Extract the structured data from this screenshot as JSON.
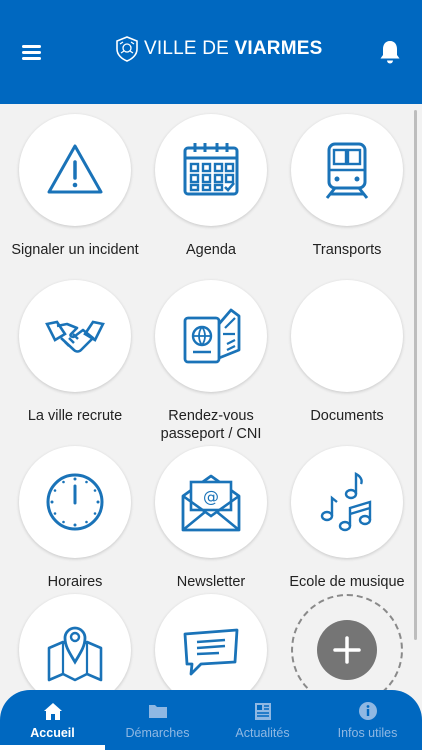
{
  "header": {
    "logo_text_light": "VILLE DE ",
    "logo_text_bold": "VIARMES",
    "menu_icon": "hamburger-menu-icon",
    "bell_icon": "bell-icon"
  },
  "tiles": [
    {
      "label": "Signaler un incident",
      "icon": "warning-icon"
    },
    {
      "label": "Agenda",
      "icon": "calendar-icon"
    },
    {
      "label": "Transports",
      "icon": "train-icon"
    },
    {
      "label": "La ville recrute",
      "icon": "handshake-icon"
    },
    {
      "label": "Rendez-vous passeport / CNI",
      "icon": "passport-icon"
    },
    {
      "label": "Documents",
      "icon": ""
    },
    {
      "label": "Horaires",
      "icon": "clock-icon"
    },
    {
      "label": "Newsletter",
      "icon": "email-envelope-icon"
    },
    {
      "label": "Ecole de musique",
      "icon": "music-notes-icon"
    },
    {
      "label": "",
      "icon": "map-pin-icon"
    },
    {
      "label": "",
      "icon": "chat-message-icon"
    }
  ],
  "add_button_icon": "plus-icon",
  "tabs": [
    {
      "label": "Accueil",
      "icon": "home-icon",
      "active": true
    },
    {
      "label": "Démarches",
      "icon": "folder-icon",
      "active": false
    },
    {
      "label": "Actualités",
      "icon": "newspaper-icon",
      "active": false
    },
    {
      "label": "Infos utiles",
      "icon": "info-icon",
      "active": false
    }
  ],
  "colors": {
    "brand_blue": "#0068c0",
    "icon_blue": "#1a73b8",
    "tab_inactive": "#8fb8e3"
  }
}
